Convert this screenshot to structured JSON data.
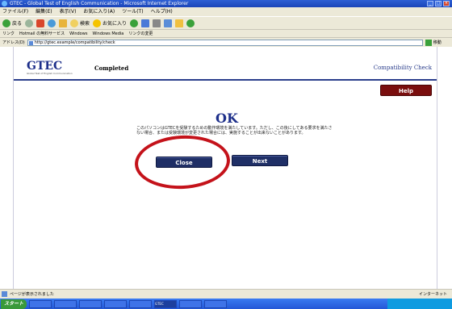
{
  "window": {
    "title": "GTEC - Global Test of English Communication - Microsoft Internet Explorer"
  },
  "menubar": {
    "items": [
      "ファイル(F)",
      "編集(E)",
      "表示(V)",
      "お気に入り(A)",
      "ツール(T)",
      "ヘルプ(H)"
    ]
  },
  "toolbar": {
    "back_label": "戻る",
    "search_label": "検索",
    "favorites_label": "お気に入り"
  },
  "links": {
    "label": "リンク",
    "items": [
      "Hotmail の無料サービス",
      "Windows",
      "Windows Media",
      "リンクの変更"
    ]
  },
  "address": {
    "label": "アドレス(D)",
    "value": "http://gtec.example/compatibility/check",
    "go_label": "移動"
  },
  "page": {
    "logo": "GTEC",
    "logo_sub": "Global Test of English Communication",
    "status_heading": "Completed",
    "compat_label": "Compatibility Check",
    "help_label": "Help",
    "ok_title": "OK",
    "message": "このパソコンはGTECを受験するための動作環境を満たしています。ただし、この後にしてある要求を満たさない場合、または受験環境が変更された場合には、実施することが出来ないことがあります。",
    "close_label": "Close",
    "next_label": "Next"
  },
  "statusbar": {
    "text": "ページが表示されました",
    "zone": "インターネット"
  },
  "taskbar": {
    "start_label": "スタート",
    "tasks": [
      "",
      "",
      "",
      "",
      "",
      "GTEC",
      "",
      ""
    ]
  },
  "colors": {
    "brand": "#1d2f8a",
    "help_button": "#7a0e0e",
    "action_button": "#1f2f66",
    "highlight_ring": "#c4121a"
  }
}
